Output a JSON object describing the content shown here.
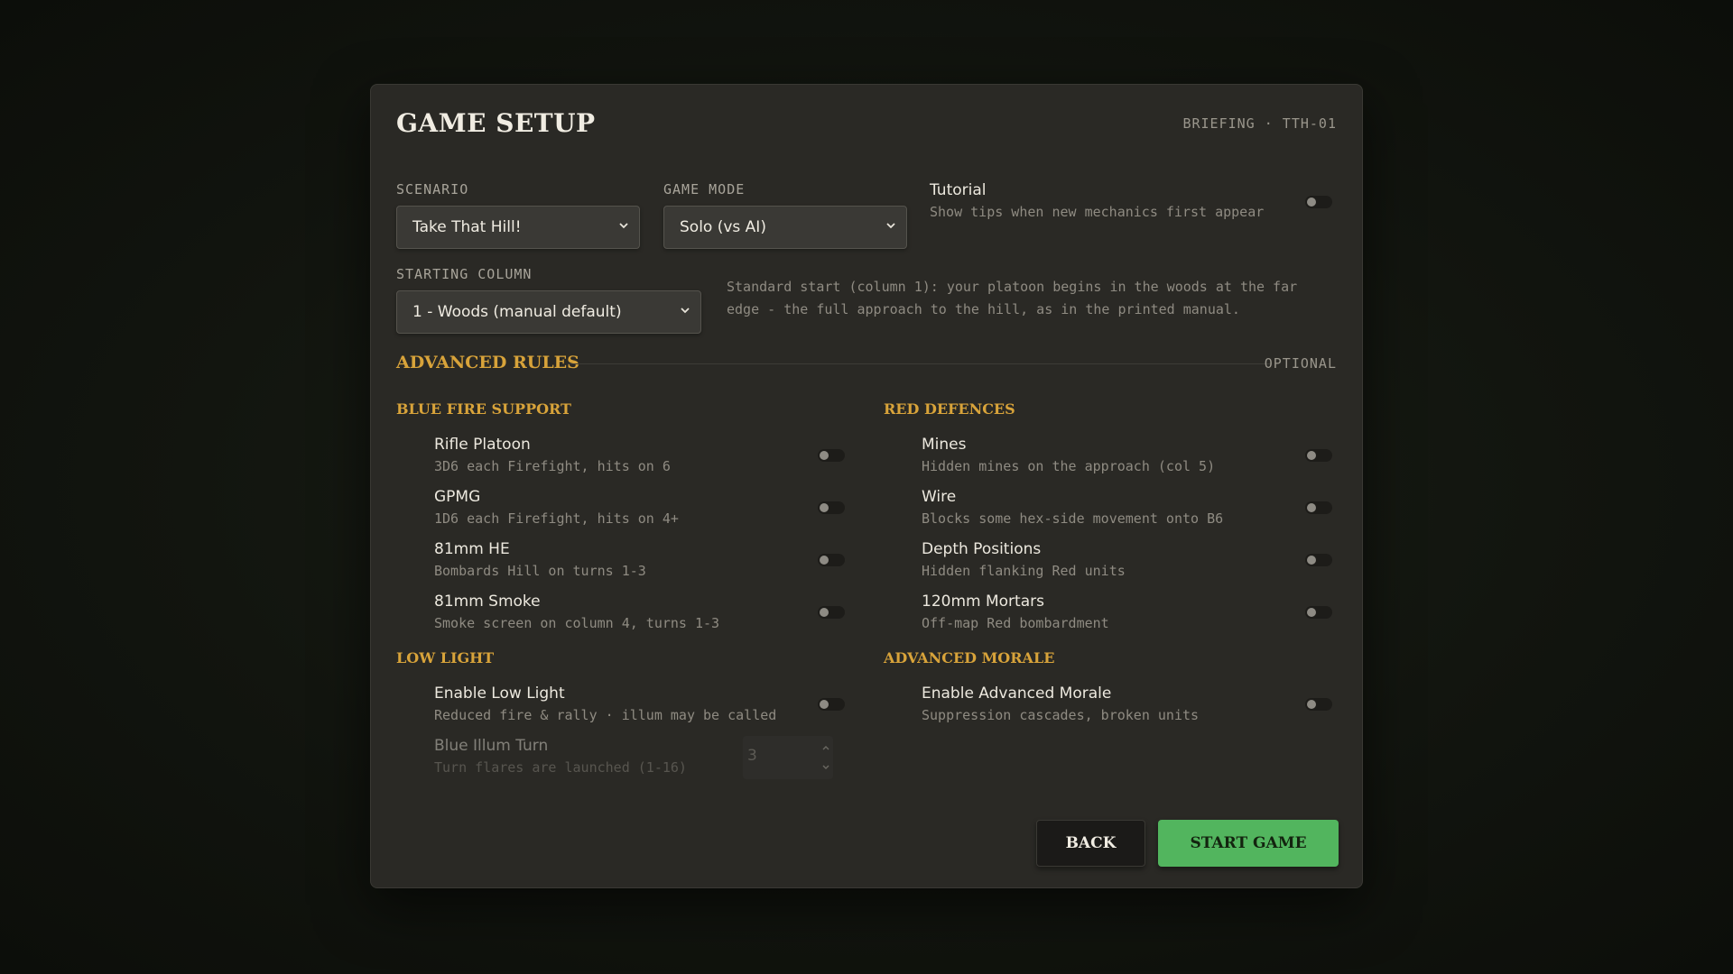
{
  "header": {
    "title": "GAME SETUP",
    "briefing": "BRIEFING · TTH-01"
  },
  "scenario": {
    "label": "SCENARIO",
    "value": "Take That Hill!"
  },
  "game_mode": {
    "label": "GAME MODE",
    "value": "Solo (vs AI)"
  },
  "tutorial": {
    "title": "Tutorial",
    "desc": "Show tips when new mechanics first appear",
    "on": false
  },
  "starting_column": {
    "label": "STARTING COLUMN",
    "value": "1 - Woods (manual default)",
    "note": "Standard start (column 1): your platoon begins in the woods at the far edge - the full approach to the hill, as in the printed manual."
  },
  "advanced": {
    "title": "ADVANCED RULES",
    "optional": "OPTIONAL",
    "blue_fire": {
      "title": "BLUE FIRE SUPPORT",
      "items": [
        {
          "title": "Rifle Platoon",
          "desc": "3D6 each Firefight, hits on 6",
          "on": false
        },
        {
          "title": "GPMG",
          "desc": "1D6 each Firefight, hits on 4+",
          "on": false
        },
        {
          "title": "81mm HE",
          "desc": "Bombards Hill on turns 1-3",
          "on": false
        },
        {
          "title": "81mm Smoke",
          "desc": "Smoke screen on column 4, turns 1-3",
          "on": false
        }
      ]
    },
    "red_defences": {
      "title": "RED DEFENCES",
      "items": [
        {
          "title": "Mines",
          "desc": "Hidden mines on the approach (col 5)",
          "on": false
        },
        {
          "title": "Wire",
          "desc": "Blocks some hex-side movement onto B6",
          "on": false
        },
        {
          "title": "Depth Positions",
          "desc": "Hidden flanking Red units",
          "on": false
        },
        {
          "title": "120mm Mortars",
          "desc": "Off-map Red bombardment",
          "on": false
        }
      ]
    },
    "low_light": {
      "title": "LOW LIGHT",
      "enable": {
        "title": "Enable Low Light",
        "desc": "Reduced fire & rally · illum may be called",
        "on": false
      },
      "illum": {
        "title": "Blue Illum Turn",
        "desc": "Turn flares are launched (1-16)",
        "value": "3"
      }
    },
    "advanced_morale": {
      "title": "ADVANCED MORALE",
      "enable": {
        "title": "Enable Advanced Morale",
        "desc": "Suppression cascades, broken units",
        "on": false
      }
    }
  },
  "buttons": {
    "back": "BACK",
    "start": "START GAME"
  },
  "colors": {
    "accent": "#d8a33a",
    "start_button": "#52b55e",
    "panel": "#2a2925"
  }
}
